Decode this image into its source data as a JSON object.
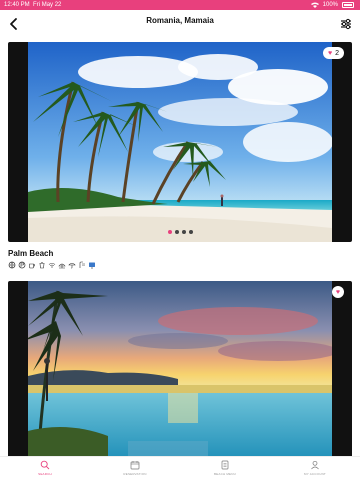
{
  "status_bar": {
    "time": "12:40 PM",
    "date": "Fri May 22",
    "battery": "100%"
  },
  "header": {
    "title": "Romania, Mamaia",
    "back_icon": "chevron-left-icon",
    "filter_icon": "sliders-icon"
  },
  "listings": [
    {
      "title": "Palm Beach",
      "likes": "2",
      "photo_count": 4,
      "active_photo": 1,
      "amenity_icons": [
        "globe-icon",
        "parking-icon",
        "coffee-icon",
        "trash-icon",
        "wifi-icon",
        "beach-icon",
        "umbrella-icon",
        "shower-icon",
        "tv-icon"
      ]
    },
    {
      "title": "",
      "likes": "",
      "photo_count": 0,
      "active_photo": 0
    }
  ],
  "tab_bar": {
    "tabs": [
      {
        "label": "SEARCH",
        "icon": "search-icon",
        "active": true
      },
      {
        "label": "RESERVATION",
        "icon": "calendar-icon",
        "active": false
      },
      {
        "label": "BEACH MENU",
        "icon": "menu-icon",
        "active": false
      },
      {
        "label": "MY ACCOUNT",
        "icon": "user-icon",
        "active": false
      }
    ]
  },
  "colors": {
    "accent": "#e8407d",
    "inactive": "#999999"
  }
}
